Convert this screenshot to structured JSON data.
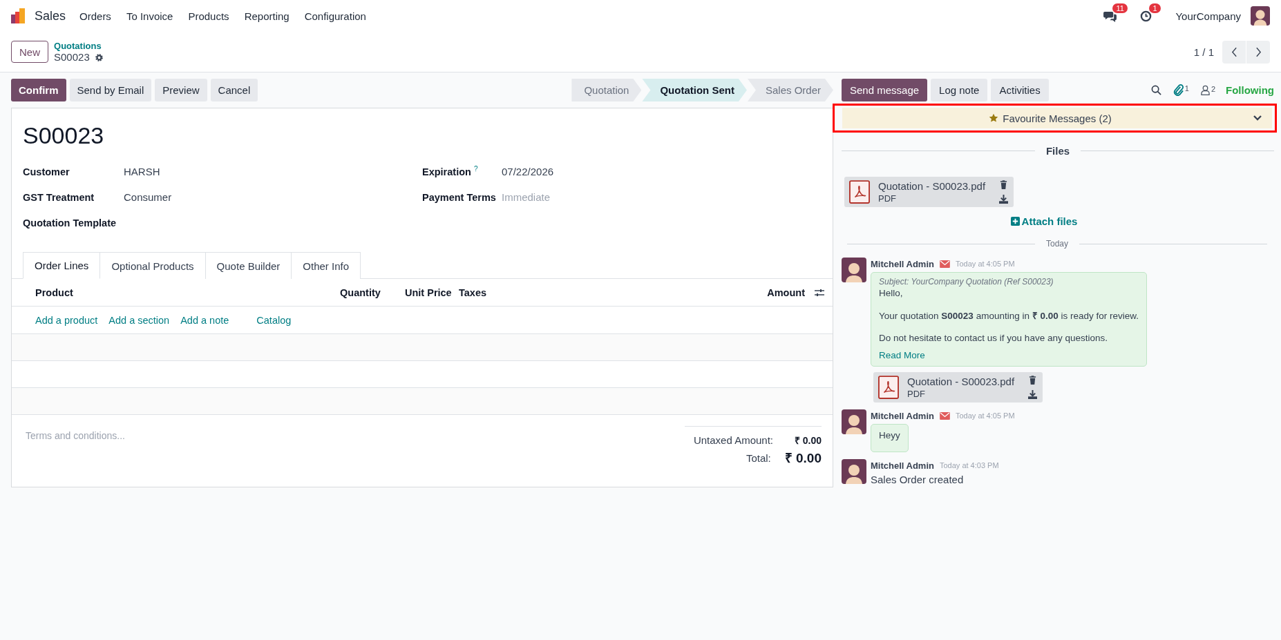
{
  "navbar": {
    "app_name": "Sales",
    "menu": [
      "Orders",
      "To Invoice",
      "Products",
      "Reporting",
      "Configuration"
    ],
    "messages_badge": "11",
    "activities_badge": "1",
    "company": "YourCompany"
  },
  "control_panel": {
    "new_button": "New",
    "breadcrumb": "Quotations",
    "record": "S00023",
    "pager": "1 / 1"
  },
  "actions": [
    {
      "label": "Confirm",
      "kind": "primary"
    },
    {
      "label": "Send by Email",
      "kind": "secondary"
    },
    {
      "label": "Preview",
      "kind": "secondary"
    },
    {
      "label": "Cancel",
      "kind": "secondary"
    }
  ],
  "status_steps": [
    {
      "label": "Quotation",
      "selected": false
    },
    {
      "label": "Quotation Sent",
      "selected": true
    },
    {
      "label": "Sales Order",
      "selected": false
    }
  ],
  "form": {
    "title": "S00023",
    "left_fields": [
      {
        "label": "Customer",
        "value": "HARSH"
      },
      {
        "label": "GST Treatment",
        "value": "Consumer"
      },
      {
        "label": "Quotation Template"
      }
    ],
    "right_fields": [
      {
        "label": "Expiration",
        "help": "?",
        "value": "07/22/2026"
      },
      {
        "label": "Payment Terms",
        "placeholder": "Immediate"
      }
    ],
    "tabs": [
      {
        "label": "Order Lines",
        "selected": true
      },
      {
        "label": "Optional Products",
        "selected": false
      },
      {
        "label": "Quote Builder",
        "selected": false
      },
      {
        "label": "Other Info",
        "selected": false
      }
    ],
    "columns": [
      "Product",
      "Quantity",
      "Unit Price",
      "Taxes",
      "Amount"
    ],
    "add_links": [
      "Add a product",
      "Add a section",
      "Add a note",
      "Catalog"
    ],
    "terms_placeholder": "Terms and conditions...",
    "totals": [
      {
        "label": "Untaxed Amount:",
        "value": "₹ 0.00",
        "kind": "sub"
      },
      {
        "label": "Total:",
        "value": "₹ 0.00",
        "kind": "grand"
      }
    ]
  },
  "chatter": {
    "buttons": [
      {
        "label": "Send message",
        "selected": true
      },
      {
        "label": "Log note",
        "selected": false
      },
      {
        "label": "Activities",
        "selected": false
      }
    ],
    "attachments_count": "1",
    "followers_count": "2",
    "follow": "Following",
    "favourites": "Favourite Messages (2)",
    "files_heading": "Files",
    "files": [
      {
        "name": "Quotation - S00023.pdf",
        "type": "PDF"
      }
    ],
    "attach": "Attach files",
    "date_separator": "Today",
    "messages": [
      {
        "author": "Mitchell Admin",
        "via_email": true,
        "time": "Today at 4:05 PM",
        "kind": "bubble",
        "subject": "Subject: YourCompany Quotation (Ref S00023)",
        "paragraphs": [
          "Hello,",
          "Your quotation **S00023** amounting in **₹ 0.00** is ready for review.",
          "Do not hesitate to contact us if you have any questions."
        ],
        "read_more": "Read More",
        "attachment": {
          "name": "Quotation - S00023.pdf",
          "type": "PDF"
        }
      },
      {
        "author": "Mitchell Admin",
        "via_email": true,
        "time": "Today at 4:05 PM",
        "kind": "bubble",
        "paragraphs": [
          "Heyy"
        ]
      },
      {
        "author": "Mitchell Admin",
        "via_email": false,
        "time": "Today at 4:03 PM",
        "kind": "plain",
        "paragraphs": [
          "Sales Order created"
        ]
      }
    ]
  }
}
